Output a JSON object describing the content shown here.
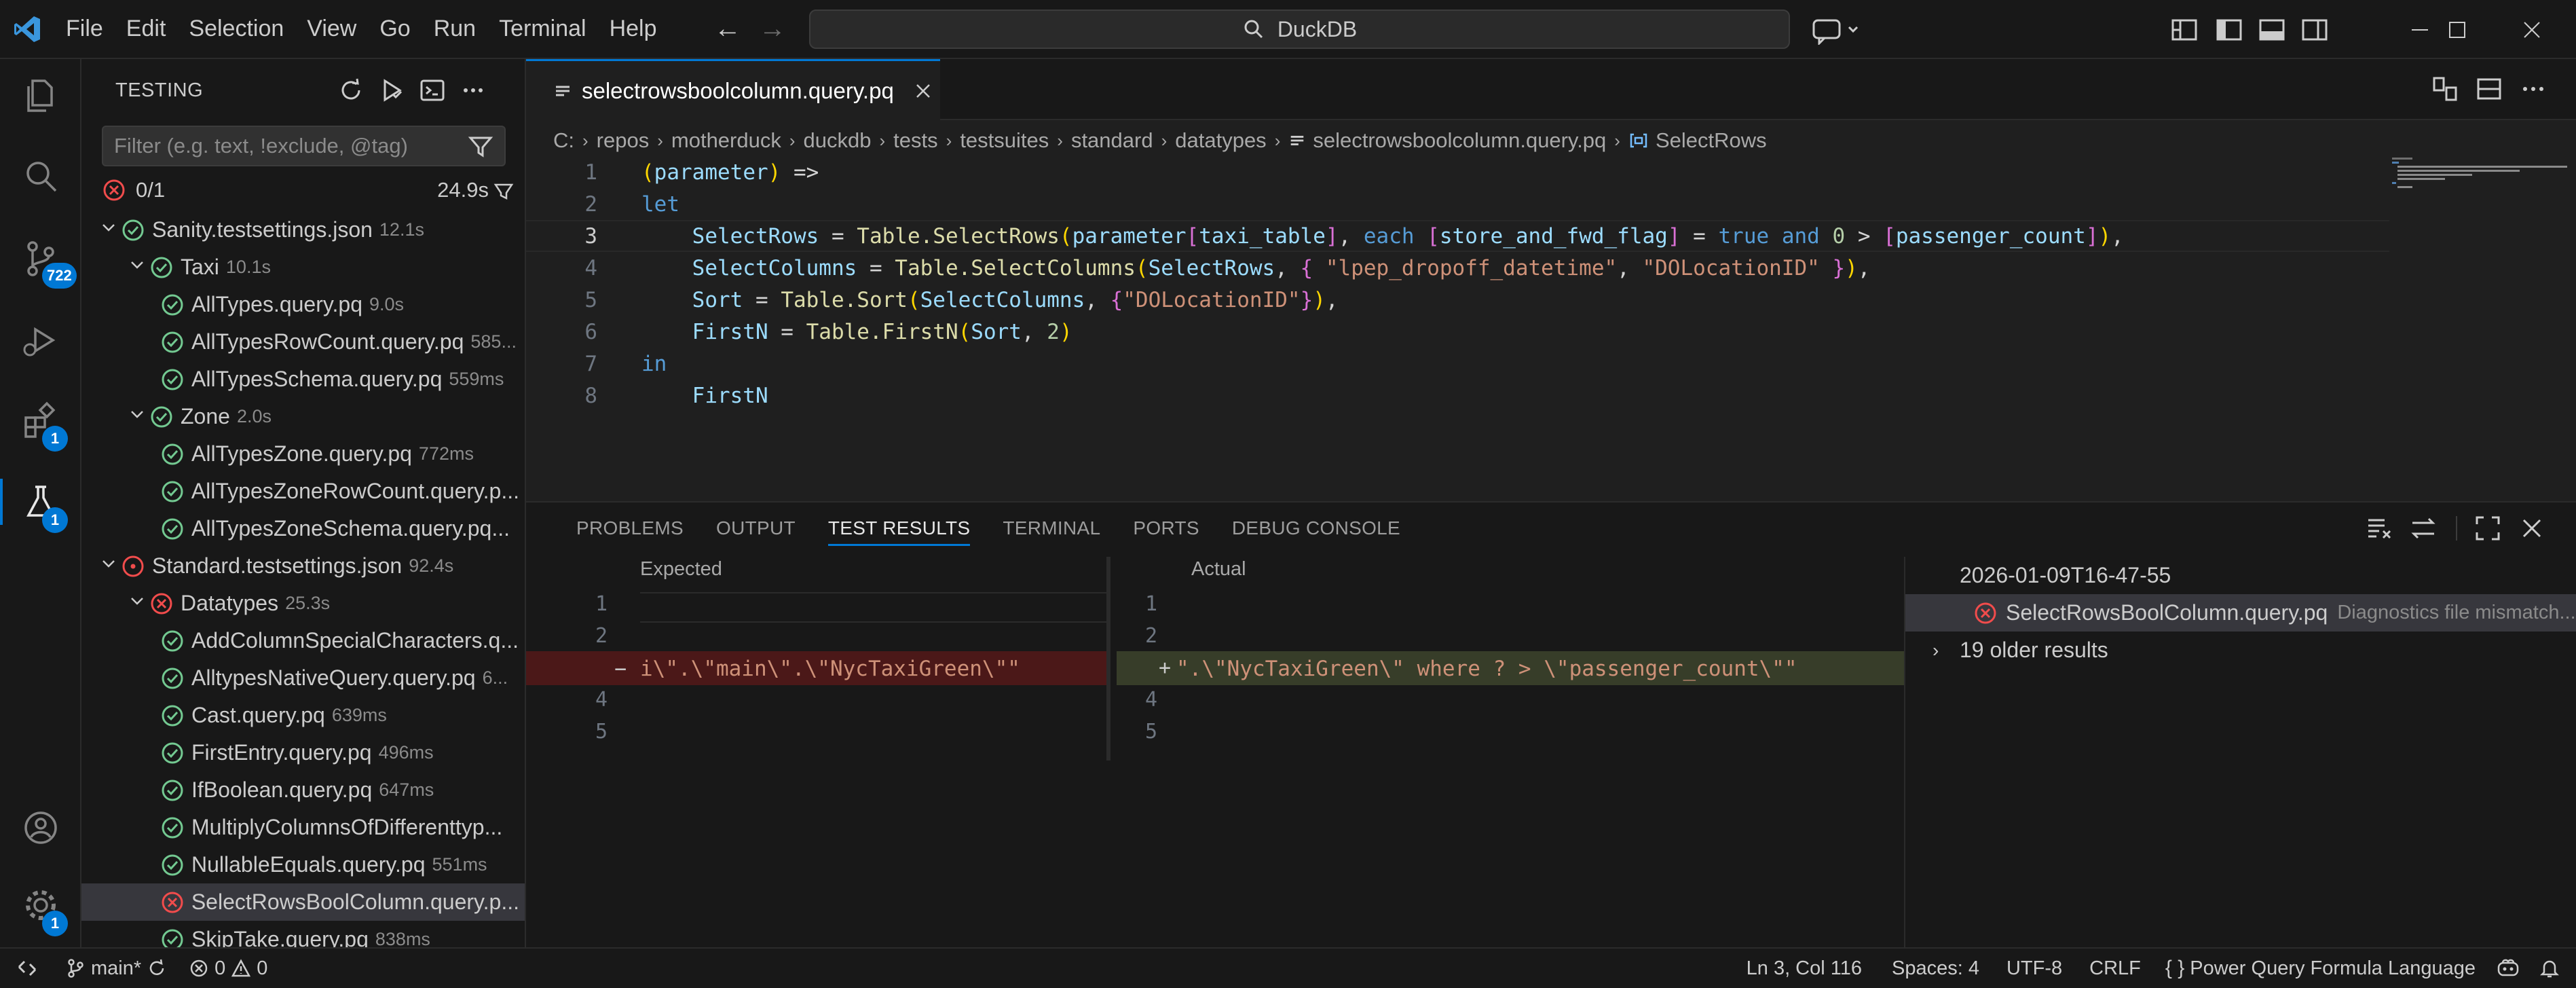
{
  "menu": [
    "File",
    "Edit",
    "Selection",
    "View",
    "Go",
    "Run",
    "Terminal",
    "Help"
  ],
  "search": {
    "text": "DuckDB"
  },
  "activity": {
    "source_control_badge": "722",
    "extensions_badge": "1",
    "testing_badge": "1",
    "manage_badge": "1"
  },
  "sidebar": {
    "title": "TESTING",
    "filter_placeholder": "Filter (e.g. text, !exclude, @tag)",
    "summary_count": "0/1",
    "summary_time": "24.9s",
    "tree": [
      {
        "label": "Sanity.testsettings.json",
        "duration": "12.1s",
        "status": "pass",
        "level": 0,
        "expanded": true
      },
      {
        "label": "Taxi",
        "duration": "10.1s",
        "status": "pass",
        "level": 1,
        "expanded": true
      },
      {
        "label": "AllTypes.query.pq",
        "duration": "9.0s",
        "status": "pass",
        "level": 2
      },
      {
        "label": "AllTypesRowCount.query.pq",
        "duration": "585...",
        "status": "pass",
        "level": 2
      },
      {
        "label": "AllTypesSchema.query.pq",
        "duration": "559ms",
        "status": "pass",
        "level": 2
      },
      {
        "label": "Zone",
        "duration": "2.0s",
        "status": "pass",
        "level": 1,
        "expanded": true
      },
      {
        "label": "AllTypesZone.query.pq",
        "duration": "772ms",
        "status": "pass",
        "level": 2
      },
      {
        "label": "AllTypesZoneRowCount.query.p...",
        "duration": "",
        "status": "pass",
        "level": 2
      },
      {
        "label": "AllTypesZoneSchema.query.pq...",
        "duration": "",
        "status": "pass",
        "level": 2
      },
      {
        "label": "Standard.testsettings.json",
        "duration": "92.4s",
        "status": "error",
        "level": 0,
        "expanded": true
      },
      {
        "label": "Datatypes",
        "duration": "25.3s",
        "status": "fail",
        "level": 1,
        "expanded": true
      },
      {
        "label": "AddColumnSpecialCharacters.q...",
        "duration": "",
        "status": "pass",
        "level": 2
      },
      {
        "label": "AlltypesNativeQuery.query.pq",
        "duration": "6...",
        "status": "pass",
        "level": 2
      },
      {
        "label": "Cast.query.pq",
        "duration": "639ms",
        "status": "pass",
        "level": 2
      },
      {
        "label": "FirstEntry.query.pq",
        "duration": "496ms",
        "status": "pass",
        "level": 2
      },
      {
        "label": "IfBoolean.query.pq",
        "duration": "647ms",
        "status": "pass",
        "level": 2
      },
      {
        "label": "MultiplyColumnsOfDifferenttyp...",
        "duration": "",
        "status": "pass",
        "level": 2
      },
      {
        "label": "NullableEquals.query.pq",
        "duration": "551ms",
        "status": "pass",
        "level": 2
      },
      {
        "label": "SelectRowsBoolColumn.query.p...",
        "duration": "",
        "status": "fail",
        "level": 2,
        "selected": true
      },
      {
        "label": "SkipTake.query.pq",
        "duration": "838ms",
        "status": "pass",
        "level": 2
      }
    ]
  },
  "editor": {
    "tab_label": "selectrowsboolcolumn.query.pq",
    "breadcrumb": [
      "C:",
      "repos",
      "motherduck",
      "duckdb",
      "tests",
      "testsuites",
      "standard",
      "datatypes"
    ],
    "breadcrumb_file": "selectrowsboolcolumn.query.pq",
    "breadcrumb_symbol": "SelectRows",
    "line_numbers": [
      "1",
      "2",
      "3",
      "4",
      "5",
      "6",
      "7",
      "8"
    ]
  },
  "panel": {
    "tabs": [
      "PROBLEMS",
      "OUTPUT",
      "TEST RESULTS",
      "TERMINAL",
      "PORTS",
      "DEBUG CONSOLE"
    ],
    "expected_title": "Expected",
    "actual_title": "Actual",
    "expected_line3": "i\\\".\\\"main\\\".\\\"NycTaxiGreen\\\"\"",
    "actual_line3": "\".\\\"NycTaxiGreen\\\" where ? > \\\"passenger_count\\\"\"",
    "diff_line_numbers": [
      "1",
      "2",
      "3",
      "4",
      "5"
    ],
    "history": {
      "run_time": "2026-01-09T16-47-55",
      "result_label": "SelectRowsBoolColumn.query.pq",
      "result_message": "Diagnostics file mismatch...",
      "older": "19 older results"
    }
  },
  "status": {
    "branch": "main*",
    "errors": "0",
    "warnings": "0",
    "position": "Ln 3, Col 116",
    "spaces": "Spaces: 4",
    "encoding": "UTF-8",
    "eol": "CRLF",
    "language": "Power Query Formula Language"
  },
  "colors": {
    "accent": "#0078d4",
    "pass": "#73c991",
    "fail": "#f14c4c",
    "removed_bg": "#4b1818",
    "added_bg": "#373d29"
  }
}
